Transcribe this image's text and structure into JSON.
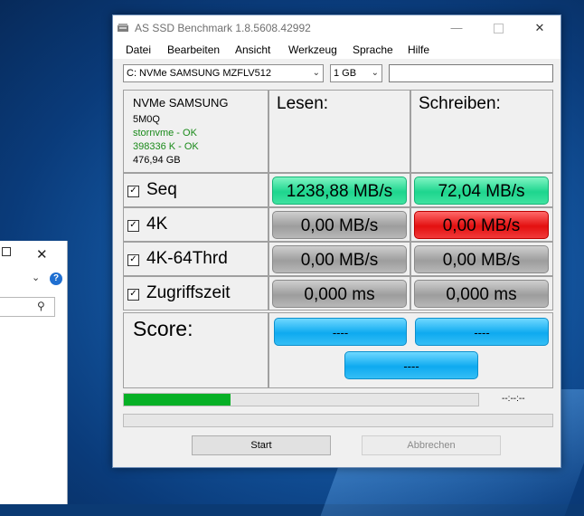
{
  "window": {
    "title": "AS SSD Benchmark 1.8.5608.42992",
    "min_glyph": "—",
    "close_glyph": "✕"
  },
  "menu": [
    "Datei",
    "Bearbeiten",
    "Ansicht",
    "Werkzeug",
    "Sprache",
    "Hilfe"
  ],
  "toolbar": {
    "drive": "C: NVMe SAMSUNG MZFLV512",
    "size": "1 GB",
    "name_value": ""
  },
  "drive_info": {
    "model": "NVMe SAMSUNG",
    "firmware": "5M0Q",
    "driver_status": "stornvme - OK",
    "alignment_status": "398336 K - OK",
    "capacity": "476,94 GB"
  },
  "columns": {
    "read": "Lesen:",
    "write": "Schreiben:"
  },
  "rows": [
    {
      "label": "Seq",
      "checked": true,
      "read": "1238,88 MB/s",
      "write": "72,04 MB/s"
    },
    {
      "label": "4K",
      "checked": true,
      "read": "0,00 MB/s",
      "write": "0,00 MB/s"
    },
    {
      "label": "4K-64Thrd",
      "checked": true,
      "read": "0,00 MB/s",
      "write": "0,00 MB/s"
    },
    {
      "label": "Zugriffszeit",
      "checked": true,
      "read": "0,000 ms",
      "write": "0,000 ms"
    }
  ],
  "score": {
    "label": "Score:",
    "read": "----",
    "write": "----",
    "total": "----"
  },
  "progress": {
    "fraction": 0.3,
    "time": "--:--:--"
  },
  "buttons": {
    "start": "Start",
    "cancel": "Abbrechen"
  },
  "colors": {
    "good": "#1ed58e",
    "bad": "#e31010",
    "neutral": "#9d9d9d",
    "score": "#0eaaf0",
    "progress": "#06b025"
  },
  "background_window": {
    "help_glyph": "?",
    "close_glyph": "✕"
  }
}
